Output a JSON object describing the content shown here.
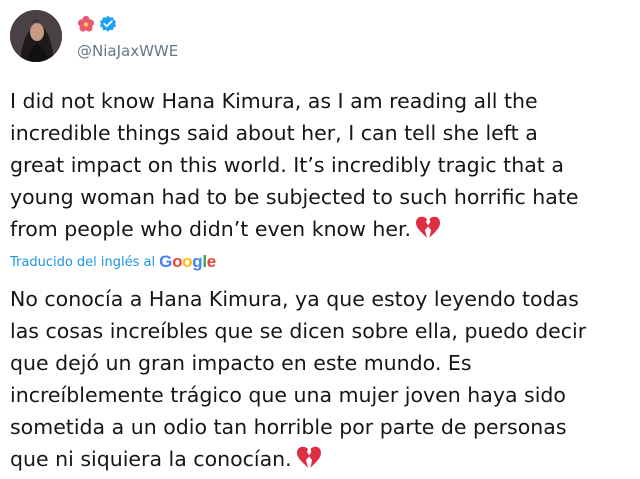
{
  "user": {
    "handle": "@NiaJaxWWE",
    "name_emoji": "hibiscus-icon",
    "verified": true
  },
  "tweet": {
    "original_lines": [
      "I did not know Hana Kimura, as I am reading all the",
      "incredible things said about her, I can tell she left a",
      "great impact on this world. It’s incredibly tragic that a",
      "young woman had to be subjected to such horrific hate",
      "from people who didn’t even know her."
    ],
    "translation_label": "Traducido del inglés al",
    "translation_provider": "Google",
    "translated_lines": [
      "No conocía a Hana Kimura, ya que estoy leyendo todas",
      "las cosas increíbles que se dicen sobre ella, puedo decir",
      "que dejó un gran impacto en este mundo. Es",
      "increíblemente trágico que una mujer joven haya sido",
      "sometida a un odio tan horrible por parte de personas",
      "que ni siquiera la conocían."
    ],
    "emoji": "broken-heart-icon"
  },
  "colors": {
    "text": "#14171a",
    "secondary": "#657786",
    "link": "#1b95e0",
    "verified": "#1da1f2",
    "broken_heart": "#dd2e44"
  }
}
